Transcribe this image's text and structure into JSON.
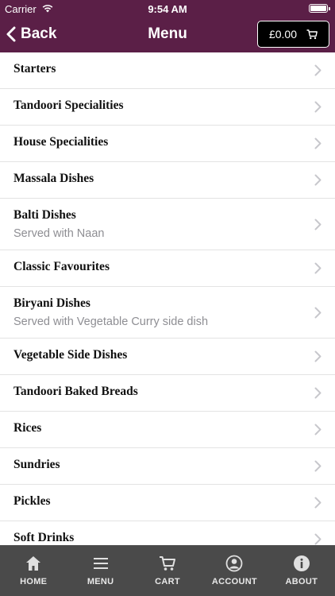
{
  "status_bar": {
    "carrier": "Carrier",
    "time": "9:54 AM"
  },
  "header": {
    "back_label": "Back",
    "title": "Menu",
    "cart_amount": "£0.00",
    "background_color": "#5b1f47"
  },
  "menu_items": [
    {
      "title": "Starters",
      "subtitle": ""
    },
    {
      "title": "Tandoori Specialities",
      "subtitle": ""
    },
    {
      "title": "House Specialities",
      "subtitle": ""
    },
    {
      "title": "Massala Dishes",
      "subtitle": ""
    },
    {
      "title": "Balti Dishes",
      "subtitle": "Served with Naan"
    },
    {
      "title": "Classic Favourites",
      "subtitle": ""
    },
    {
      "title": "Biryani Dishes",
      "subtitle": "Served with Vegetable Curry side dish"
    },
    {
      "title": "Vegetable Side Dishes",
      "subtitle": ""
    },
    {
      "title": "Tandoori Baked Breads",
      "subtitle": ""
    },
    {
      "title": "Rices",
      "subtitle": ""
    },
    {
      "title": "Sundries",
      "subtitle": ""
    },
    {
      "title": "Pickles",
      "subtitle": ""
    },
    {
      "title": "Soft Drinks",
      "subtitle": ""
    }
  ],
  "tab_bar": {
    "tabs": [
      {
        "label": "HOME",
        "icon": "home-icon"
      },
      {
        "label": "MENU",
        "icon": "menu-icon"
      },
      {
        "label": "CART",
        "icon": "cart-icon"
      },
      {
        "label": "ACCOUNT",
        "icon": "account-icon"
      },
      {
        "label": "ABOUT",
        "icon": "info-icon"
      }
    ],
    "background_color": "#4a4a4a"
  }
}
